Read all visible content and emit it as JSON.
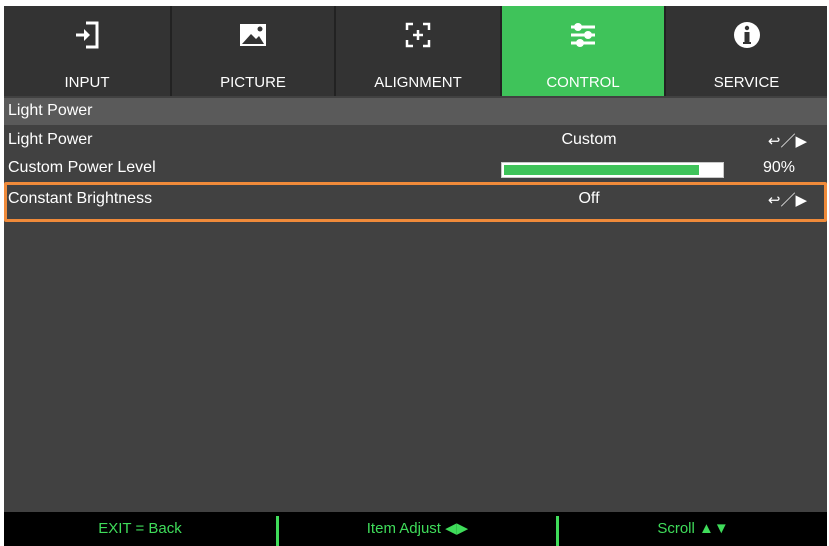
{
  "tabs": [
    {
      "label": "INPUT",
      "icon": "input-icon",
      "active": false
    },
    {
      "label": "PICTURE",
      "icon": "picture-icon",
      "active": false
    },
    {
      "label": "ALIGNMENT",
      "icon": "alignment-icon",
      "active": false
    },
    {
      "label": "CONTROL",
      "icon": "sliders-icon",
      "active": true
    },
    {
      "label": "SERVICE",
      "icon": "info-icon",
      "active": false
    }
  ],
  "section_title": "Light Power",
  "rows": [
    {
      "name": "Light Power",
      "value": "Custom",
      "action": "↩／▶"
    },
    {
      "name": "Custom Power Level",
      "progress": 0.9,
      "percent": "90%"
    },
    {
      "name": "Constant Brightness",
      "value": "Off",
      "action": "↩／▶"
    }
  ],
  "footer": {
    "back": "EXIT = Back",
    "adjust": "Item Adjust ◀▶",
    "scroll": "Scroll ▲▼"
  },
  "colors": {
    "accent": "#3fc35a",
    "highlight": "#ef8a3a",
    "background": "#414141"
  }
}
